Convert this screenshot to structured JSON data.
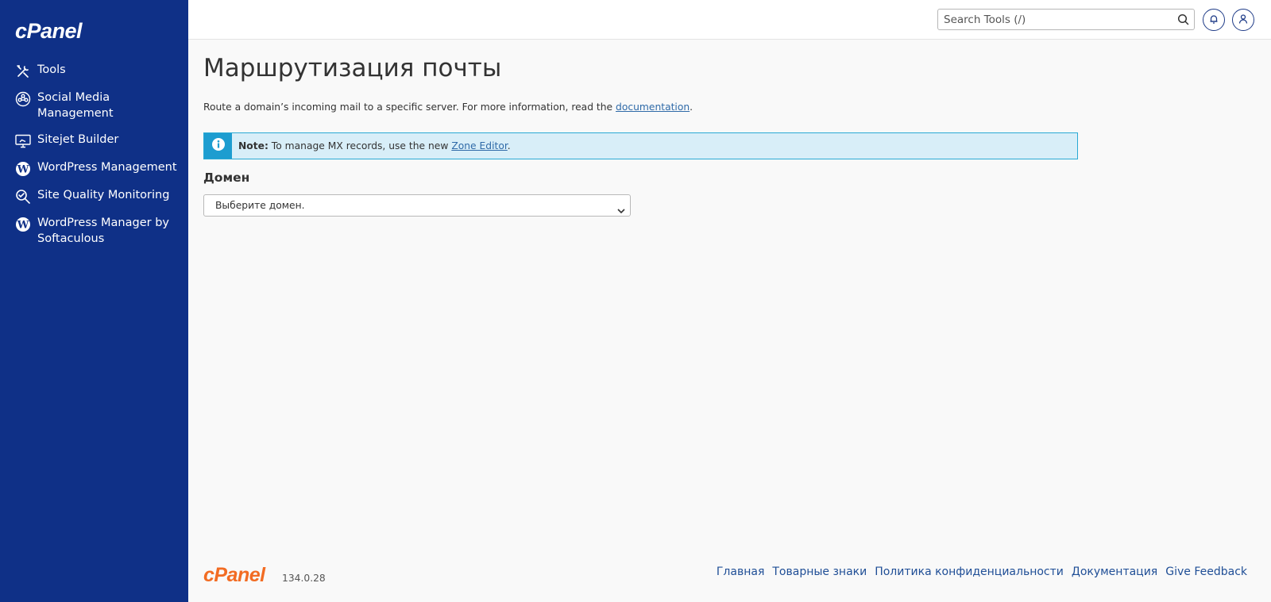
{
  "brand": {
    "logo": "cPanel",
    "version": "134.0.28"
  },
  "sidebar": {
    "items": [
      {
        "label": "Tools",
        "icon": "tools-icon"
      },
      {
        "label": "Social Media Management",
        "icon": "social-media-icon"
      },
      {
        "label": "Sitejet Builder",
        "icon": "monitor-icon"
      },
      {
        "label": "WordPress Management",
        "icon": "wordpress-icon"
      },
      {
        "label": "Site Quality Monitoring",
        "icon": "magnifier-icon"
      },
      {
        "label": "WordPress Manager by Softaculous",
        "icon": "wordpress-icon"
      }
    ]
  },
  "header": {
    "search_placeholder": "Search Tools (/)",
    "notifications_icon": "bell-icon",
    "user_icon": "user-icon"
  },
  "main": {
    "title": "Маршрутизация почты",
    "description_prefix": "Route a domain’s incoming mail to a specific server. For more information, read the ",
    "description_link": "documentation",
    "description_suffix": ".",
    "note": {
      "label": "Note:",
      "text": " To manage MX records, use the new ",
      "link": "Zone Editor",
      "suffix": "."
    },
    "domain_label": "Домен",
    "domain_select": "Выберите домен."
  },
  "footer": {
    "links": [
      "Главная",
      "Товарные знаки",
      "Политика конфиденциальности",
      "Документация",
      "Give Feedback"
    ]
  },
  "colors": {
    "sidebar_bg": "#0f3087",
    "accent_orange": "#f26c23",
    "note_bg": "#d8eef8",
    "note_border": "#29a9d4",
    "link": "#2f6aa8"
  }
}
